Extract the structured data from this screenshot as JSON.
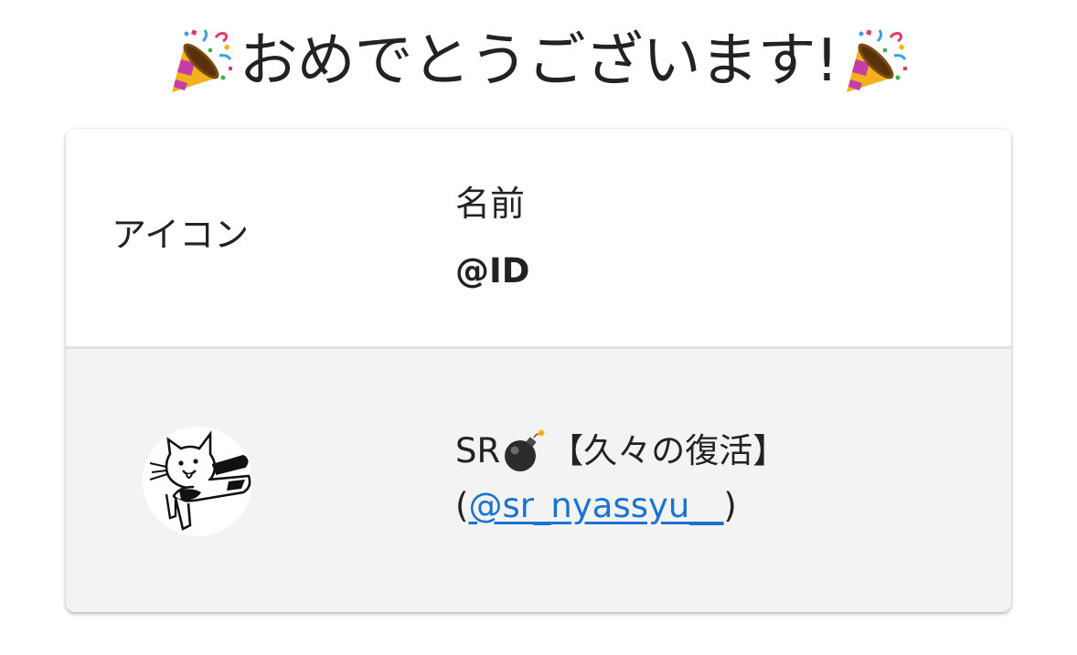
{
  "title": {
    "text": "おめでとうございます!",
    "left_icon": "party-popper-icon",
    "right_icon": "party-popper-icon"
  },
  "table": {
    "header": {
      "icon_label": "アイコン",
      "name_label": "名前",
      "id_label": "@ID"
    },
    "rows": [
      {
        "avatar": "cat-drawing-avatar",
        "name_prefix": "SR",
        "name_emoji": "bomb-icon",
        "name_suffix": "【久々の復活】",
        "id_open": "(",
        "id_link": "@sr_nyassyu__",
        "id_close": ")"
      }
    ]
  },
  "colors": {
    "link": "#1a73d1",
    "row_background": "#f3f3f3",
    "divider": "#e0e0e0"
  }
}
